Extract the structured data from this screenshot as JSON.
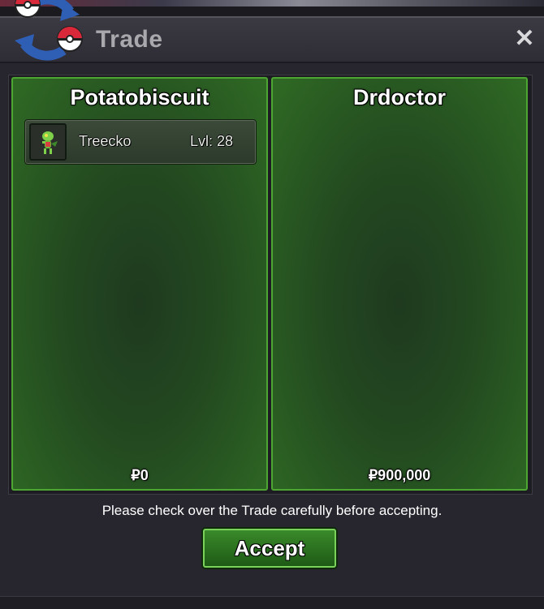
{
  "window": {
    "title": "Trade",
    "close_symbol": "✕"
  },
  "trade": {
    "left": {
      "player": "Potatobiscuit",
      "items": [
        {
          "name": "Treecko",
          "level": "Lvl: 28"
        }
      ],
      "money": "₽0"
    },
    "right": {
      "player": "Drdoctor",
      "items": [],
      "money": "₽900,000"
    }
  },
  "notice": "Please check over the Trade carefully before accepting.",
  "accept_label": "Accept",
  "colors": {
    "panel_border": "#4ea632",
    "button_border": "#7ad25a",
    "window_bg": "#27252d"
  },
  "icons": [
    "trade-logo-icon",
    "close-icon",
    "treecko-icon"
  ]
}
